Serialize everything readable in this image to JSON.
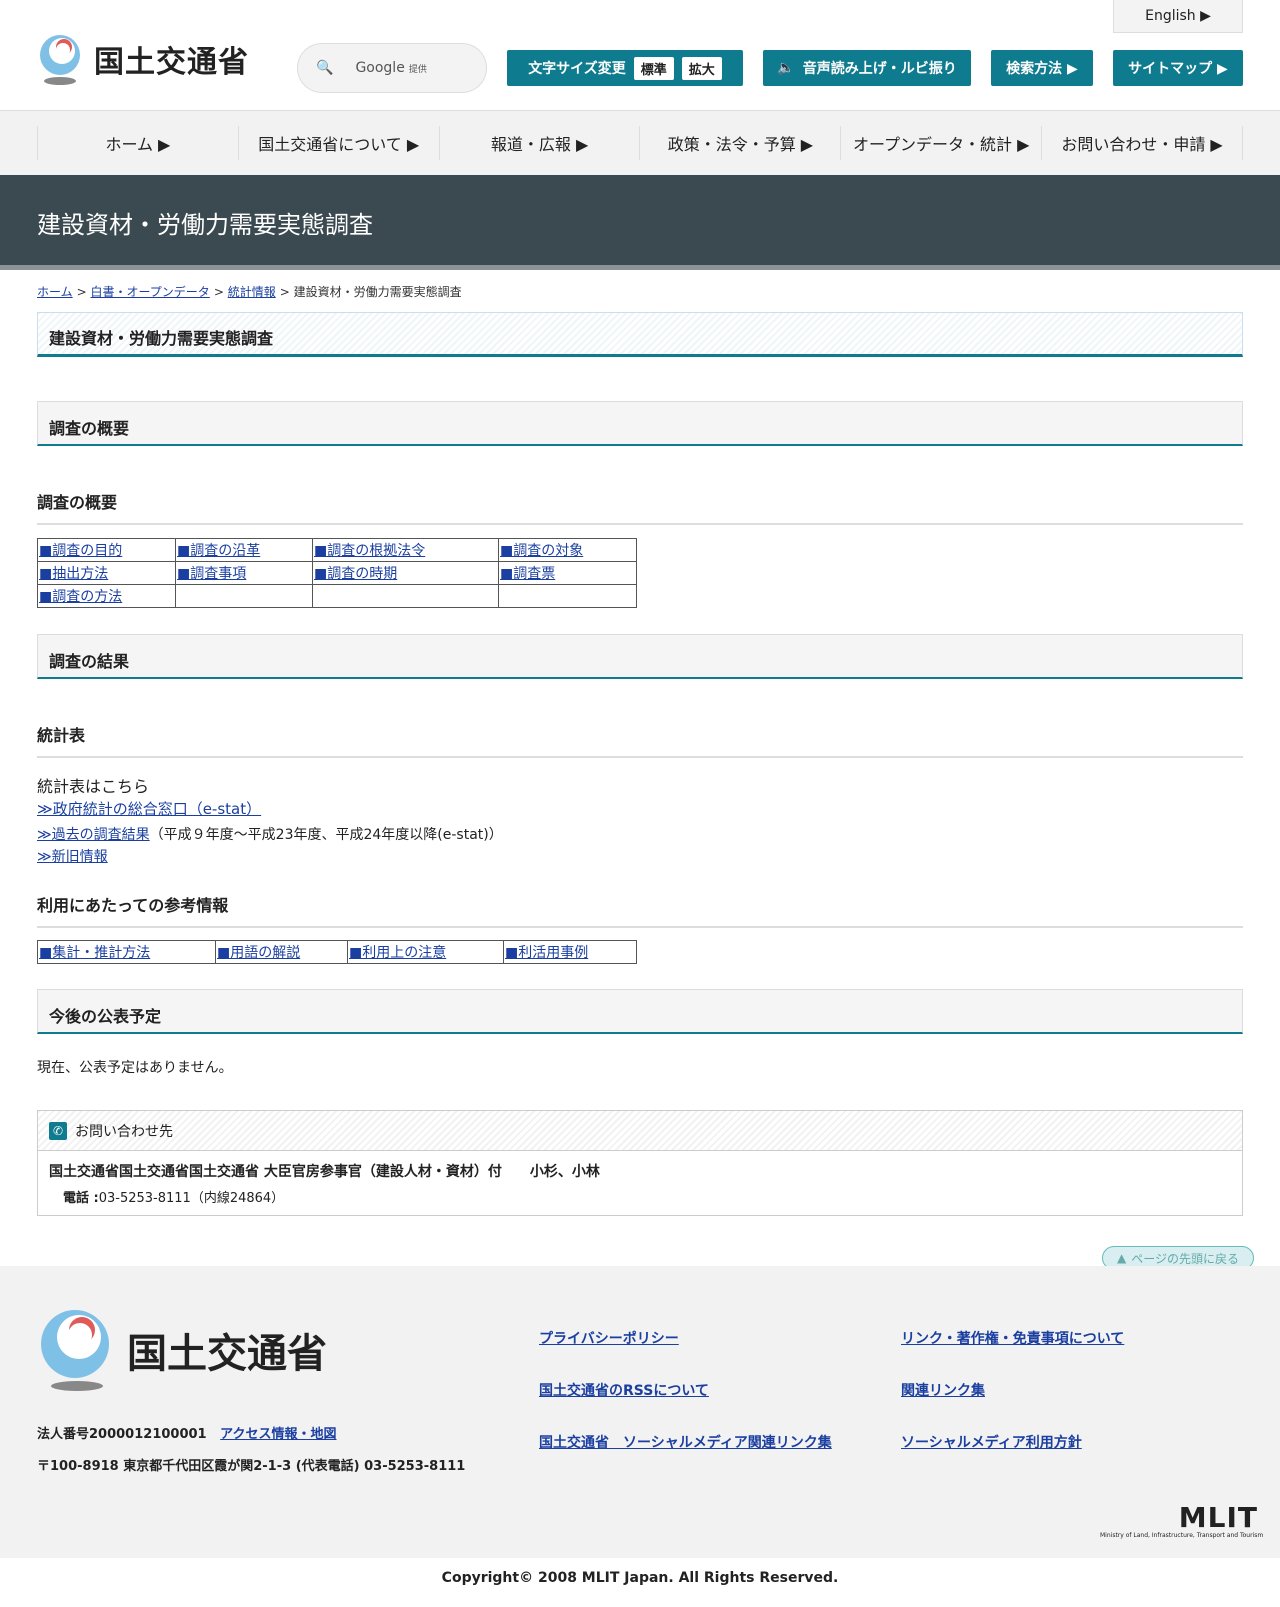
{
  "header": {
    "logo": "国土交通省",
    "search_brand": "Google",
    "search_suffix": "提供",
    "english": "English ▶",
    "font_size_label": "文字サイズ変更",
    "font_standard": "標準",
    "font_large": "拡大",
    "speech": "音声読み上げ・ルビ振り",
    "search_method": "検索方法 ▶",
    "sitemap": "サイトマップ ▶"
  },
  "nav": [
    "ホーム ▶",
    "国土交通省について ▶",
    "報道・広報 ▶",
    "政策・法令・予算 ▶",
    "オープンデータ・統計 ▶",
    "お問い合わせ・申請 ▶"
  ],
  "banner": "建設資材・労働力需要実態調査",
  "breadcrumb": {
    "items": [
      "ホーム",
      "白書・オープンデータ",
      "統計情報"
    ],
    "sep": ">",
    "current": "建設資材・労働力需要実態調査"
  },
  "page_title": "建設資材・労働力需要実態調査",
  "overview": {
    "heading": "調査の概要",
    "subheading": "調査の概要",
    "links": [
      [
        "■調査の目的",
        "■調査の沿革",
        "■調査の根拠法令",
        "■調査の対象"
      ],
      [
        "■抽出方法",
        "■調査事項",
        "■調査の時期",
        "■調査票"
      ],
      [
        "■調査の方法"
      ]
    ]
  },
  "results": {
    "heading": "調査の結果",
    "subheading": "統計表",
    "intro": "統計表はこちら",
    "estat": "≫政府統計の総合窓口（e-stat）",
    "past": "≫過去の調査結果",
    "past_note": "（平成９年度～平成23年度、平成24年度以降(e-stat)）",
    "news": "≫新旧情報"
  },
  "reference": {
    "heading": "利用にあたっての参考情報",
    "links": [
      "■集計・推計方法",
      "■用語の解説",
      "■利用上の注意",
      "■利活用事例"
    ]
  },
  "schedule": {
    "heading": "今後の公表予定",
    "text": "現在、公表予定はありません。"
  },
  "contact": {
    "heading": "お問い合わせ先",
    "org": "国土交通省国土交通省国土交通省 大臣官房参事官（建設人材・資材）付　　小杉、小林",
    "phone_label": "電話 :",
    "phone": "03-5253-8111（内線24864）"
  },
  "back_to_top": "ページの先頭に戻る",
  "footer": {
    "logo": "国土交通省",
    "corp_no": "法人番号2000012100001",
    "access": "アクセス情報・地図",
    "address": "〒100-8918 東京都千代田区霞が関2-1-3 (代表電話) 03-5253-8111",
    "links": [
      "プライバシーポリシー",
      "リンク・著作権・免責事項について",
      "国土交通省のRSSについて",
      "関連リンク集",
      "国土交通省　ソーシャルメディア関連リンク集",
      "ソーシャルメディア利用方針"
    ],
    "mlit": "MLIT",
    "mlit_sub": "Ministry of Land, Infrastructure, Transport and Tourism",
    "copyright": "Copyright© 2008 MLIT Japan. All Rights Reserved."
  }
}
